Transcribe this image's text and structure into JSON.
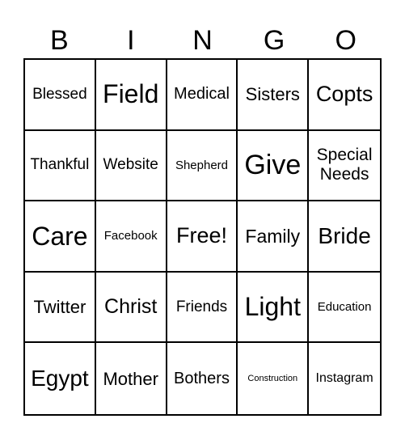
{
  "header": [
    "B",
    "I",
    "N",
    "G",
    "O"
  ],
  "cells": [
    {
      "text": "Blessed",
      "size": 19
    },
    {
      "text": "Field",
      "size": 32
    },
    {
      "text": "Medical",
      "size": 20
    },
    {
      "text": "Sisters",
      "size": 22
    },
    {
      "text": "Copts",
      "size": 27
    },
    {
      "text": "Thankful",
      "size": 19
    },
    {
      "text": "Website",
      "size": 19
    },
    {
      "text": "Shepherd",
      "size": 15
    },
    {
      "text": "Give",
      "size": 34
    },
    {
      "text": "Special Needs",
      "size": 21
    },
    {
      "text": "Care",
      "size": 32
    },
    {
      "text": "Facebook",
      "size": 15
    },
    {
      "text": "Free!",
      "size": 27
    },
    {
      "text": "Family",
      "size": 23
    },
    {
      "text": "Bride",
      "size": 28
    },
    {
      "text": "Twitter",
      "size": 22
    },
    {
      "text": "Christ",
      "size": 25
    },
    {
      "text": "Friends",
      "size": 19
    },
    {
      "text": "Light",
      "size": 32
    },
    {
      "text": "Education",
      "size": 15
    },
    {
      "text": "Egypt",
      "size": 28
    },
    {
      "text": "Mother",
      "size": 22
    },
    {
      "text": "Bothers",
      "size": 20
    },
    {
      "text": "Construction",
      "size": 11
    },
    {
      "text": "Instagram",
      "size": 16
    }
  ]
}
